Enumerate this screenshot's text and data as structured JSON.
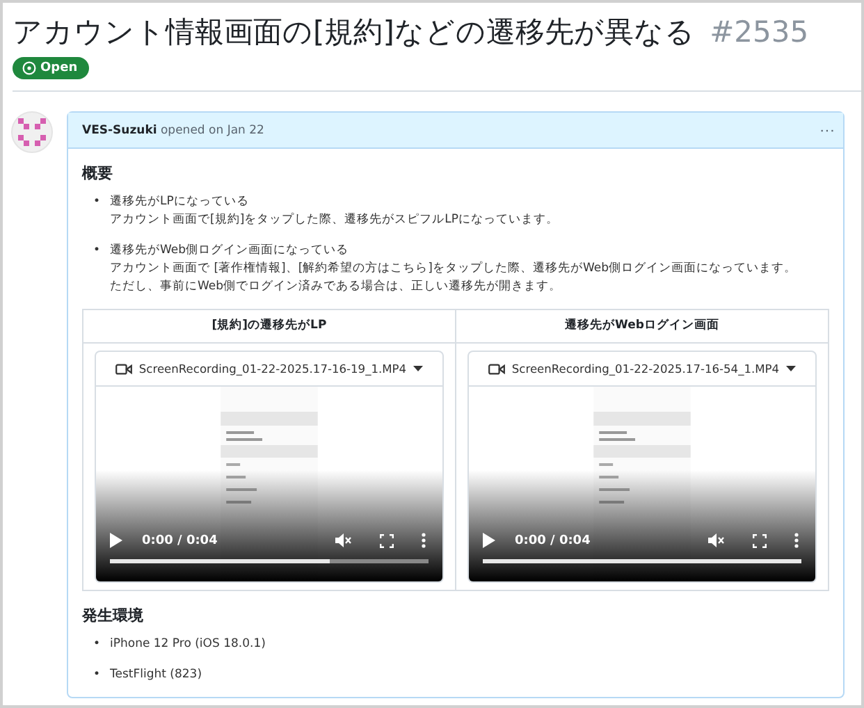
{
  "issue": {
    "title": "アカウント情報画面の[規約]などの遷移先が異なる",
    "number": "#2535",
    "status": "Open"
  },
  "comment": {
    "author": "VES-Suzuki",
    "meta": "opened on Jan 22",
    "menu": "···",
    "sections": [
      {
        "heading": "概要",
        "items": [
          {
            "bullet": "•",
            "lines": [
              "遷移先がLPになっている",
              "アカウント画面で[規約]をタップした際、遷移先がスピフルLPになっています。"
            ]
          },
          {
            "bullet": "•",
            "lines": [
              "遷移先がWeb側ログイン画面になっている",
              "アカウント画面で [著作権情報]、[解約希望の方はこちら]をタップした際、遷移先がWeb側ログイン画面になっています。",
              "ただし、事前にWeb側でログイン済みである場合は、正しい遷移先が開きます。"
            ]
          }
        ],
        "table": {
          "columns": [
            {
              "heading": "[規約]の遷移先がLP",
              "file": "ScreenRecording_01-22-2025.17-16-19_1.MP4",
              "time": "0:00 / 0:04",
              "level": 0.69
            },
            {
              "heading": "遷移先がWebログイン画面",
              "file": "ScreenRecording_01-22-2025.17-16-54_1.MP4",
              "time": "0:00 / 0:04",
              "level": 1
            }
          ]
        }
      },
      {
        "heading": "発生環境",
        "items": [
          {
            "bullet": "•",
            "lines": [
              "iPhone 12 Pro (iOS 18.0.1)"
            ]
          },
          {
            "bullet": "•",
            "lines": [
              "TestFlight (823)"
            ]
          }
        ]
      }
    ]
  }
}
